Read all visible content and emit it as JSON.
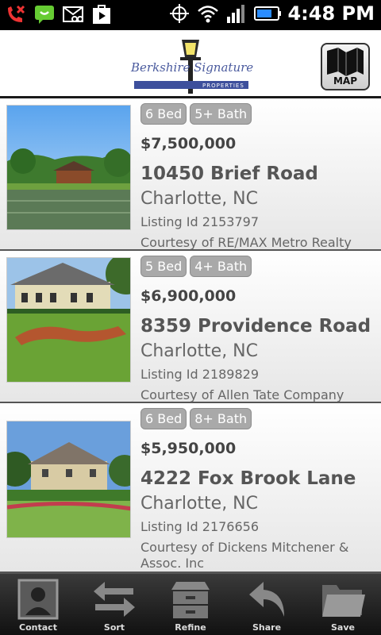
{
  "status_bar": {
    "time": "4:48 PM",
    "icons": [
      "missed-call-icon",
      "sms-icon",
      "voicemail-icon",
      "play-store-icon",
      "gps-icon",
      "wifi-icon",
      "signal-icon",
      "battery-icon"
    ]
  },
  "header": {
    "logo_text": "Berkshire Signature",
    "logo_subtext": "PROPERTIES",
    "map_label": "MAP"
  },
  "listings": [
    {
      "beds": "6 Bed",
      "baths": "5+ Bath",
      "price": "$7,500,000",
      "address": "10450 Brief Road",
      "city": "Charlotte, NC",
      "listing_id": "Listing Id 2153797",
      "courtesy": "Courtesy of RE/MAX Metro Realty"
    },
    {
      "beds": "5 Bed",
      "baths": "4+ Bath",
      "price": "$6,900,000",
      "address": "8359 Providence Road",
      "city": "Charlotte, NC",
      "listing_id": "Listing Id 2189829",
      "courtesy": "Courtesy of Allen Tate Company"
    },
    {
      "beds": "6 Bed",
      "baths": "8+ Bath",
      "price": "$5,950,000",
      "address": "4222 Fox Brook Lane",
      "city": "Charlotte, NC",
      "listing_id": "Listing Id 2176656",
      "courtesy": "Courtesy of Dickens Mitchener & Assoc. Inc"
    }
  ],
  "toolbar": {
    "contact": "Contact",
    "sort": "Sort",
    "refine": "Refine",
    "share": "Share",
    "save": "Save"
  }
}
